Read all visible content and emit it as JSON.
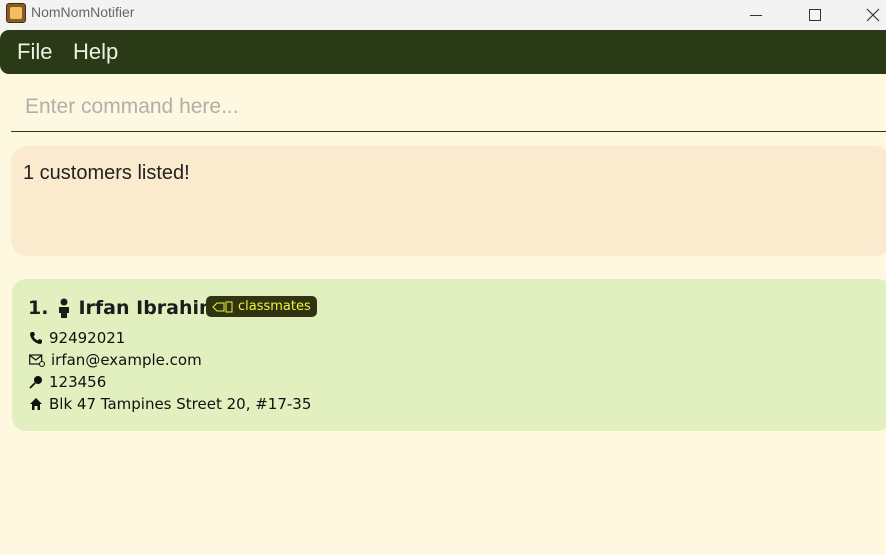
{
  "window": {
    "title": "NomNomNotifier",
    "icon": "app-icon"
  },
  "menu": {
    "file_label": "File",
    "help_label": "Help"
  },
  "command": {
    "placeholder": "Enter command here...",
    "value": ""
  },
  "result": {
    "message": "1 customers listed!"
  },
  "customers": [
    {
      "index": "1.",
      "name": "Irfan Ibrahim",
      "tag": "classmates",
      "phone": "92492021",
      "email": "irfan@example.com",
      "postal": "123456",
      "address": "Blk 47 Tampines Street 20, #17-35"
    }
  ],
  "colors": {
    "background": "#fff8e1",
    "menubar": "#2a3a16",
    "result_box": "#fbebce",
    "card": "#e2efbe",
    "tag_bg": "#2f3510",
    "tag_text": "#f2f23a"
  }
}
